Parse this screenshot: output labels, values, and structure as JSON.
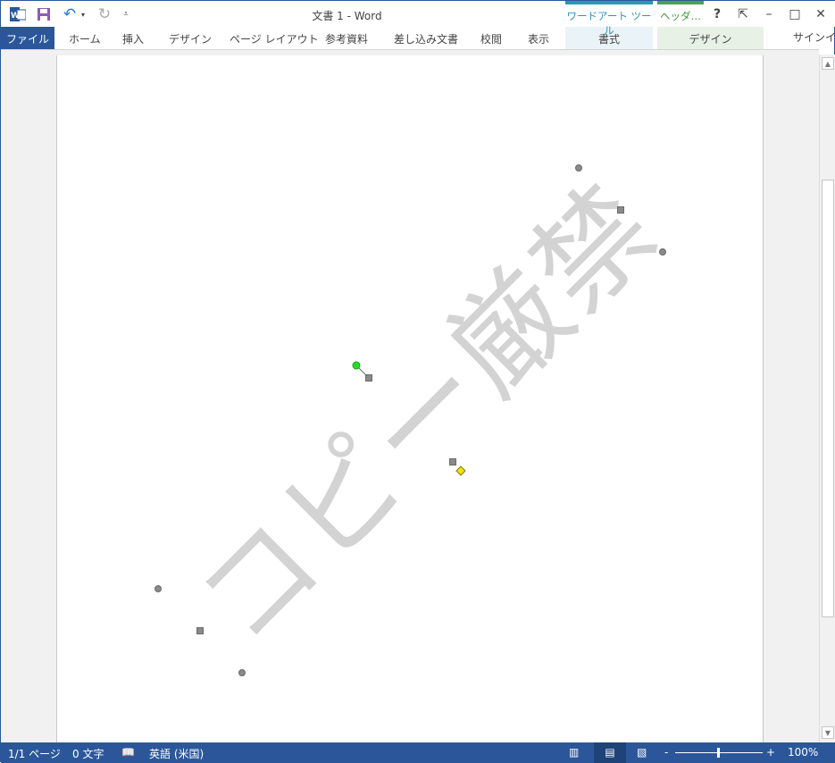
{
  "window": {
    "title": "文書 1 - Word"
  },
  "qat": {
    "word_icon": "word-app-icon",
    "save_icon": "save-icon",
    "undo_icon": "undo-icon",
    "redo_icon": "redo-icon",
    "customize_icon": "customize-qat-icon"
  },
  "ribbon": {
    "tabs": [
      {
        "label": "ファイル"
      },
      {
        "label": "ホーム"
      },
      {
        "label": "挿入"
      },
      {
        "label": "デザイン"
      },
      {
        "label": "ページ レイアウト"
      },
      {
        "label": "参考資料"
      },
      {
        "label": "差し込み文書"
      },
      {
        "label": "校閲"
      },
      {
        "label": "表示"
      }
    ],
    "contextual": [
      {
        "header": "ワードアート ツール",
        "tab": "書式",
        "color": "#2e95b5"
      },
      {
        "header": "ヘッダ…",
        "tab": "デザイン",
        "color": "#4aa24a"
      }
    ],
    "signin": "サインイン"
  },
  "window_controls": {
    "help": "?",
    "restore_ribbon": "⇱",
    "minimize": "–",
    "maximize": "□",
    "close": "✕"
  },
  "document": {
    "watermark": "コピー厳禁"
  },
  "status": {
    "page": "1/1 ページ",
    "words": "0 文字",
    "language": "英語 (米国)",
    "zoom": "100%",
    "zoom_percent": 100
  }
}
